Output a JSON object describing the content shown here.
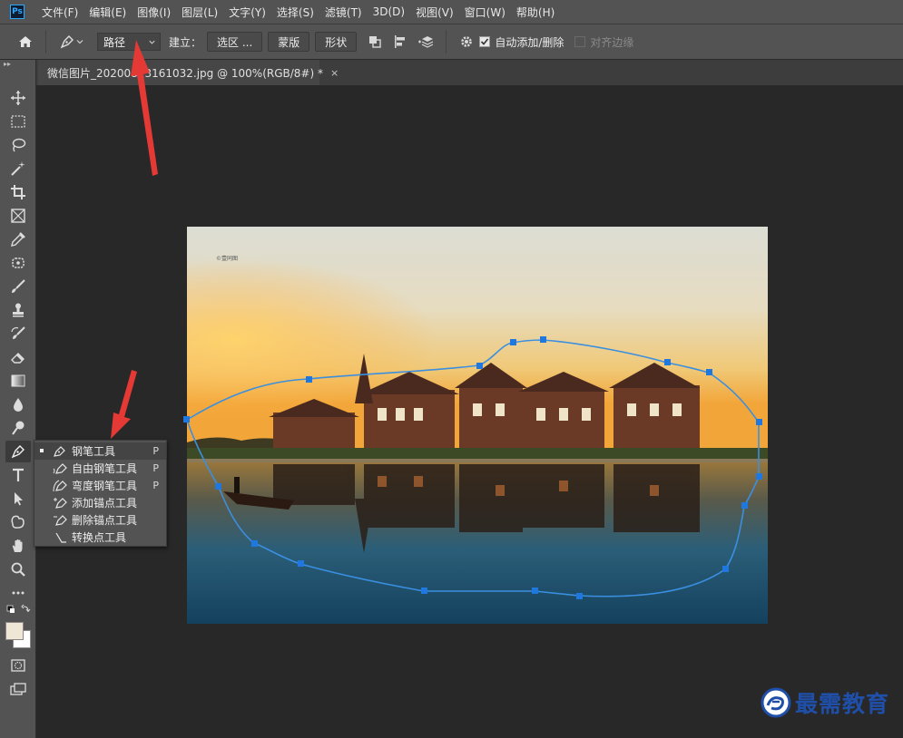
{
  "app": {
    "logo": "Ps"
  },
  "menu": [
    "文件(F)",
    "编辑(E)",
    "图像(I)",
    "图层(L)",
    "文字(Y)",
    "选择(S)",
    "滤镜(T)",
    "3D(D)",
    "视图(V)",
    "窗口(W)",
    "帮助(H)"
  ],
  "options": {
    "mode_value": "路径",
    "make_label": "建立：",
    "selection_btn": "选区 ...",
    "mask_btn": "蒙版",
    "shape_btn": "形状",
    "auto_add_label": "自动添加/删除",
    "auto_add_checked": true,
    "align_edges_label": "对齐边缘",
    "align_edges_checked": false
  },
  "document": {
    "tab_title": "微信图片_20200813161032.jpg @ 100%(RGB/8#) *",
    "close": "×",
    "photo_watermark": "©壹同图"
  },
  "flyout": {
    "items": [
      {
        "icon": "pen-icon",
        "label": "钢笔工具",
        "key": "P",
        "selected": true
      },
      {
        "icon": "freeform-pen-icon",
        "label": "自由钢笔工具",
        "key": "P",
        "selected": false
      },
      {
        "icon": "curvature-pen-icon",
        "label": "弯度钢笔工具",
        "key": "P",
        "selected": false
      },
      {
        "icon": "add-anchor-icon",
        "label": "添加锚点工具",
        "key": "",
        "selected": false
      },
      {
        "icon": "delete-anchor-icon",
        "label": "删除锚点工具",
        "key": "",
        "selected": false
      },
      {
        "icon": "convert-point-icon",
        "label": "转换点工具",
        "key": "",
        "selected": false
      }
    ]
  },
  "colors": {
    "ui_panel": "#535353",
    "canvas_bg": "#282828",
    "path_stroke": "#3a8fe0",
    "anchor": "#1e78e0",
    "arrow": "#e53935",
    "foreground_swatch": "#efe6d6",
    "background_swatch": "#ffffff",
    "watermark": "#1f4fa8"
  },
  "watermark": {
    "text": "最需教育"
  }
}
